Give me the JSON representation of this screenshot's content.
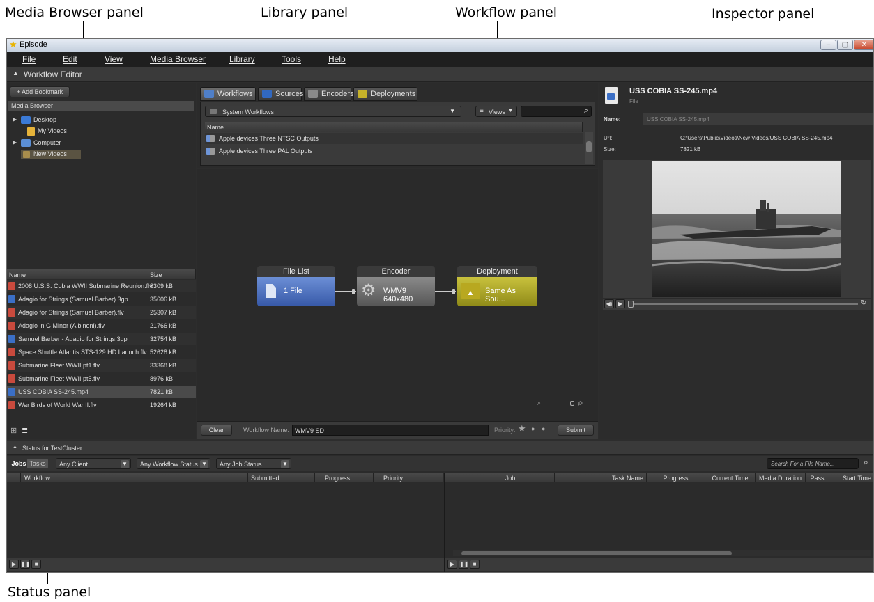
{
  "callouts": {
    "media_browser": "Media Browser panel",
    "library": "Library panel",
    "workflow": "Workflow panel",
    "inspector": "Inspector panel",
    "status": "Status panel"
  },
  "window": {
    "title": "Episode"
  },
  "menu": [
    "File",
    "Edit",
    "View",
    "Media Browser",
    "Library",
    "Tools",
    "Help"
  ],
  "workflow_editor": {
    "label": "Workflow Editor"
  },
  "media_browser": {
    "add_bookmark": "+ Add Bookmark",
    "header": "Media Browser",
    "tree": [
      "Desktop",
      "My Videos",
      "Computer",
      "New Videos"
    ],
    "columns": {
      "name": "Name",
      "size": "Size"
    },
    "files": [
      {
        "name": "2008 U.S.S. Cobia WWII Submarine Reunion.flv",
        "size": "8309 kB",
        "icon": "flv-file-icon"
      },
      {
        "name": "Adagio for Strings (Samuel Barber).3gp",
        "size": "35606 kB",
        "icon": "video-file-icon"
      },
      {
        "name": "Adagio for Strings (Samuel Barber).flv",
        "size": "25307 kB",
        "icon": "flv-file-icon"
      },
      {
        "name": "Adagio in G Minor (Albinoni).flv",
        "size": "21766 kB",
        "icon": "flv-file-icon"
      },
      {
        "name": "Samuel Barber - Adagio for Strings.3gp",
        "size": "32754 kB",
        "icon": "video-file-icon"
      },
      {
        "name": "Space Shuttle Atlantis STS-129 HD Launch.flv",
        "size": "52628 kB",
        "icon": "flv-file-icon"
      },
      {
        "name": "Submarine Fleet WWII pt1.flv",
        "size": "33368 kB",
        "icon": "flv-file-icon"
      },
      {
        "name": "Submarine Fleet WWII pt5.flv",
        "size": "8976 kB",
        "icon": "flv-file-icon"
      },
      {
        "name": "USS COBIA SS-245.mp4",
        "size": "7821 kB",
        "icon": "video-file-icon"
      },
      {
        "name": "War Birds of World War II.flv",
        "size": "19264 kB",
        "icon": "flv-file-icon"
      }
    ],
    "selected_index": 8
  },
  "library": {
    "tabs": [
      "Workflows",
      "Sources",
      "Encoders",
      "Deployments"
    ],
    "dropdown": "System Workflows",
    "views": "Views",
    "column": "Name",
    "rows": [
      "Apple devices Three NTSC Outputs",
      "Apple devices Three PAL Outputs"
    ]
  },
  "workflow": {
    "nodes": [
      {
        "title": "File List",
        "label": "1 File"
      },
      {
        "title": "Encoder",
        "label": "WMV9 640x480"
      },
      {
        "title": "Deployment",
        "label": "Same As Sou..."
      }
    ],
    "clear": "Clear",
    "name_label": "Workflow Name:",
    "name_value": "WMV9 SD",
    "priority_label": "Priority:",
    "submit": "Submit"
  },
  "inspector": {
    "title": "USS COBIA SS-245.mp4",
    "subtitle": "File",
    "name_label": "Name:",
    "name_value": "USS COBIA SS-245.mp4",
    "url_label": "Url:",
    "url_value": "C:\\Users\\Public\\Videos\\New Videos/USS COBIA SS-245.mp4",
    "size_label": "Size:",
    "size_value": "7821 kB"
  },
  "status": {
    "header": "Status for TestCluster",
    "jobs": "Jobs",
    "tasks": "Tasks",
    "filters": [
      "Any Client",
      "Any Workflow Status",
      "Any Job Status"
    ],
    "search_placeholder": "Search For a File Name...",
    "left_columns": [
      "Workflow",
      "Submitted",
      "Progress",
      "Priority"
    ],
    "right_columns": [
      "Job",
      "Task Name",
      "Progress",
      "Current Time",
      "Media Duration",
      "Pass",
      "Start Time"
    ]
  }
}
